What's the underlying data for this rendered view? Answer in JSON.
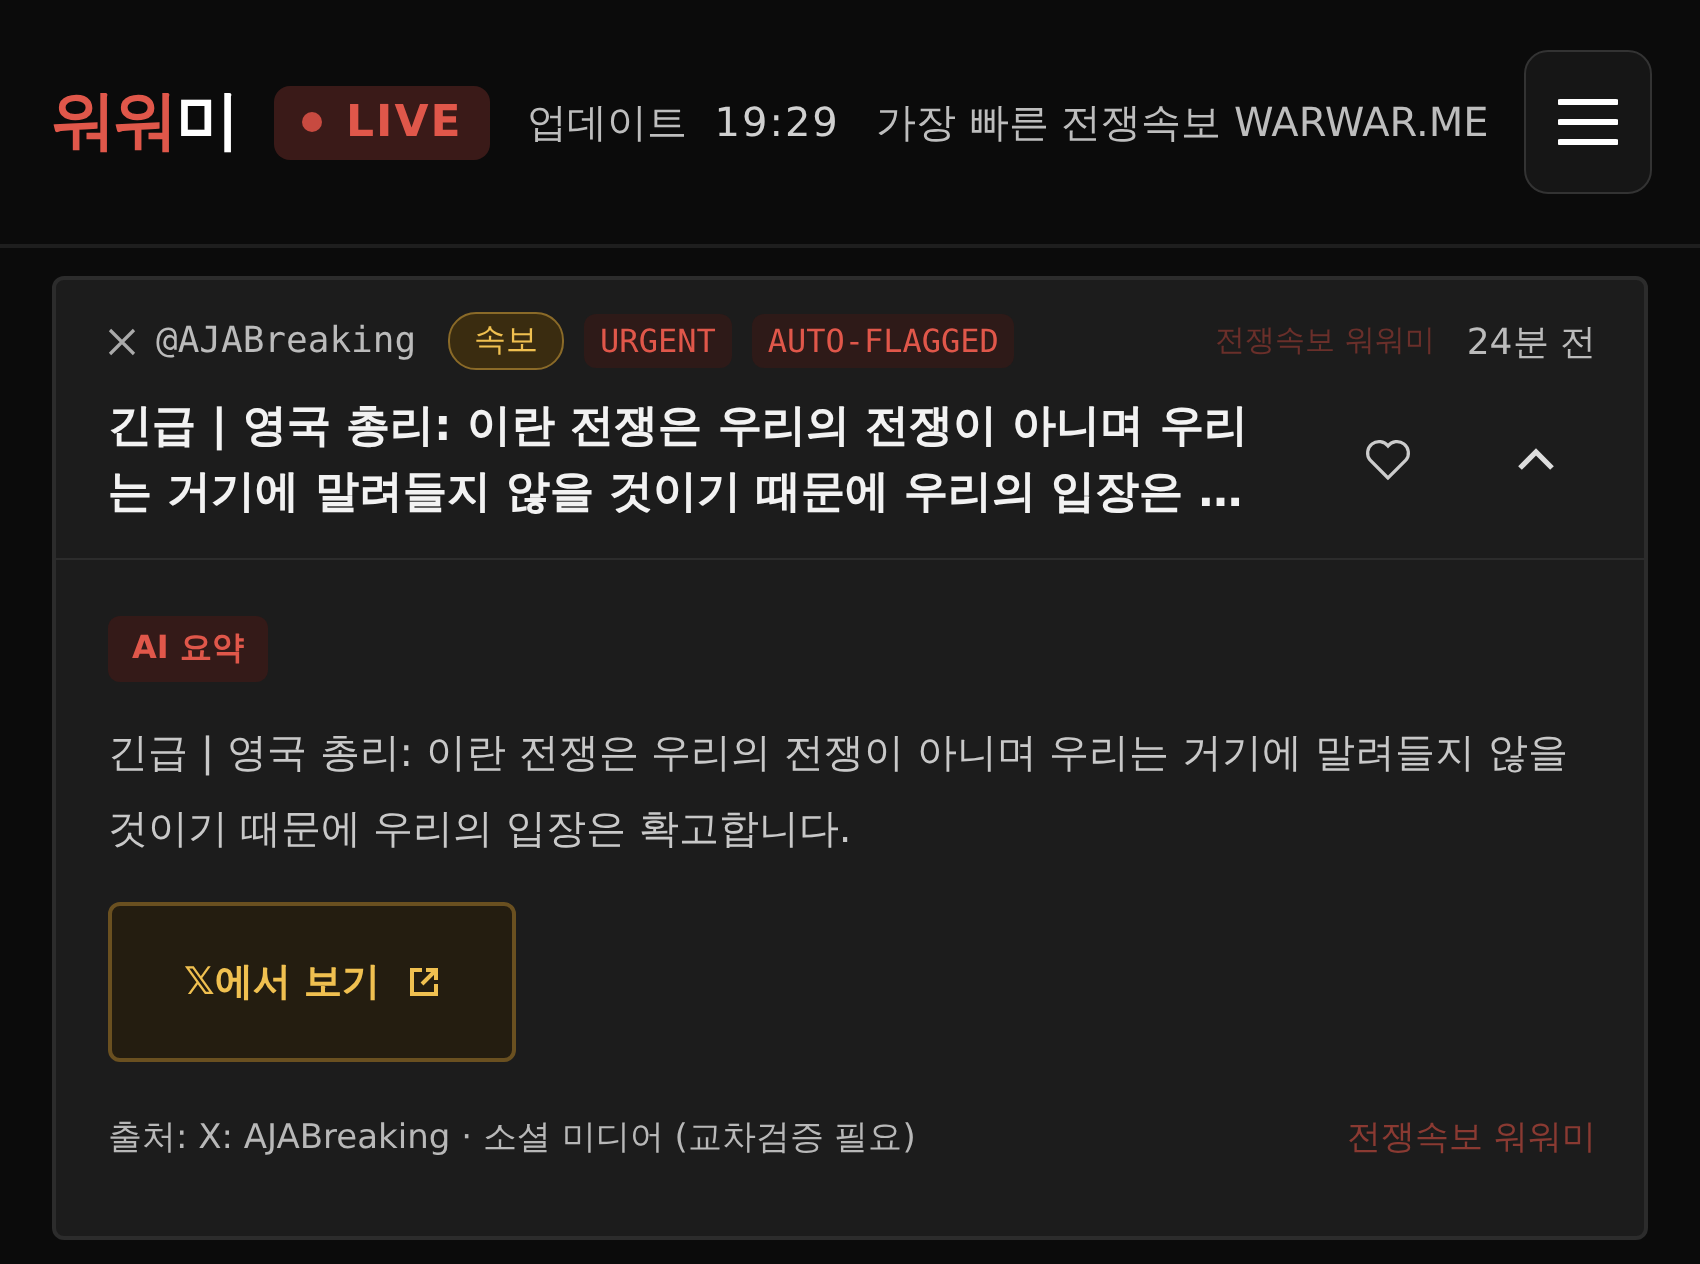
{
  "header": {
    "logo_accent": "워워",
    "logo_rest": "미",
    "live": "LIVE",
    "update_label": "업데이트",
    "update_time": "19:29",
    "tagline": "가장 빠른 전쟁속보 WARWAR.ME"
  },
  "post": {
    "handle": "@AJABreaking",
    "tags": [
      {
        "label": "속보",
        "kind": "breaking"
      },
      {
        "label": "URGENT",
        "kind": "flag"
      },
      {
        "label": "AUTO-FLAGGED",
        "kind": "flag"
      }
    ],
    "source_label": "전쟁속보 워워미",
    "time": "24분 전",
    "headline": "긴급 | 영국 총리: 이란 전쟁은 우리의 전쟁이 아니며 우리는 거기에 말려들지 않을 것이기 때문에 우리의 입장은 …",
    "liked": false,
    "expanded": true,
    "summary_badge": "AI 요약",
    "summary": "긴급 | 영국 총리: 이란 전쟁은 우리의 전쟁이 아니며 우리는 거기에 말려들지 않을 것이기 때문에 우리의 입장은 확고합니다.",
    "view_button": "𝕏에서 보기",
    "source_note": "출처: X: AJABreaking · 소셜 미디어 (교차검증 필요)",
    "footer_brand": "전쟁속보 워워미"
  }
}
